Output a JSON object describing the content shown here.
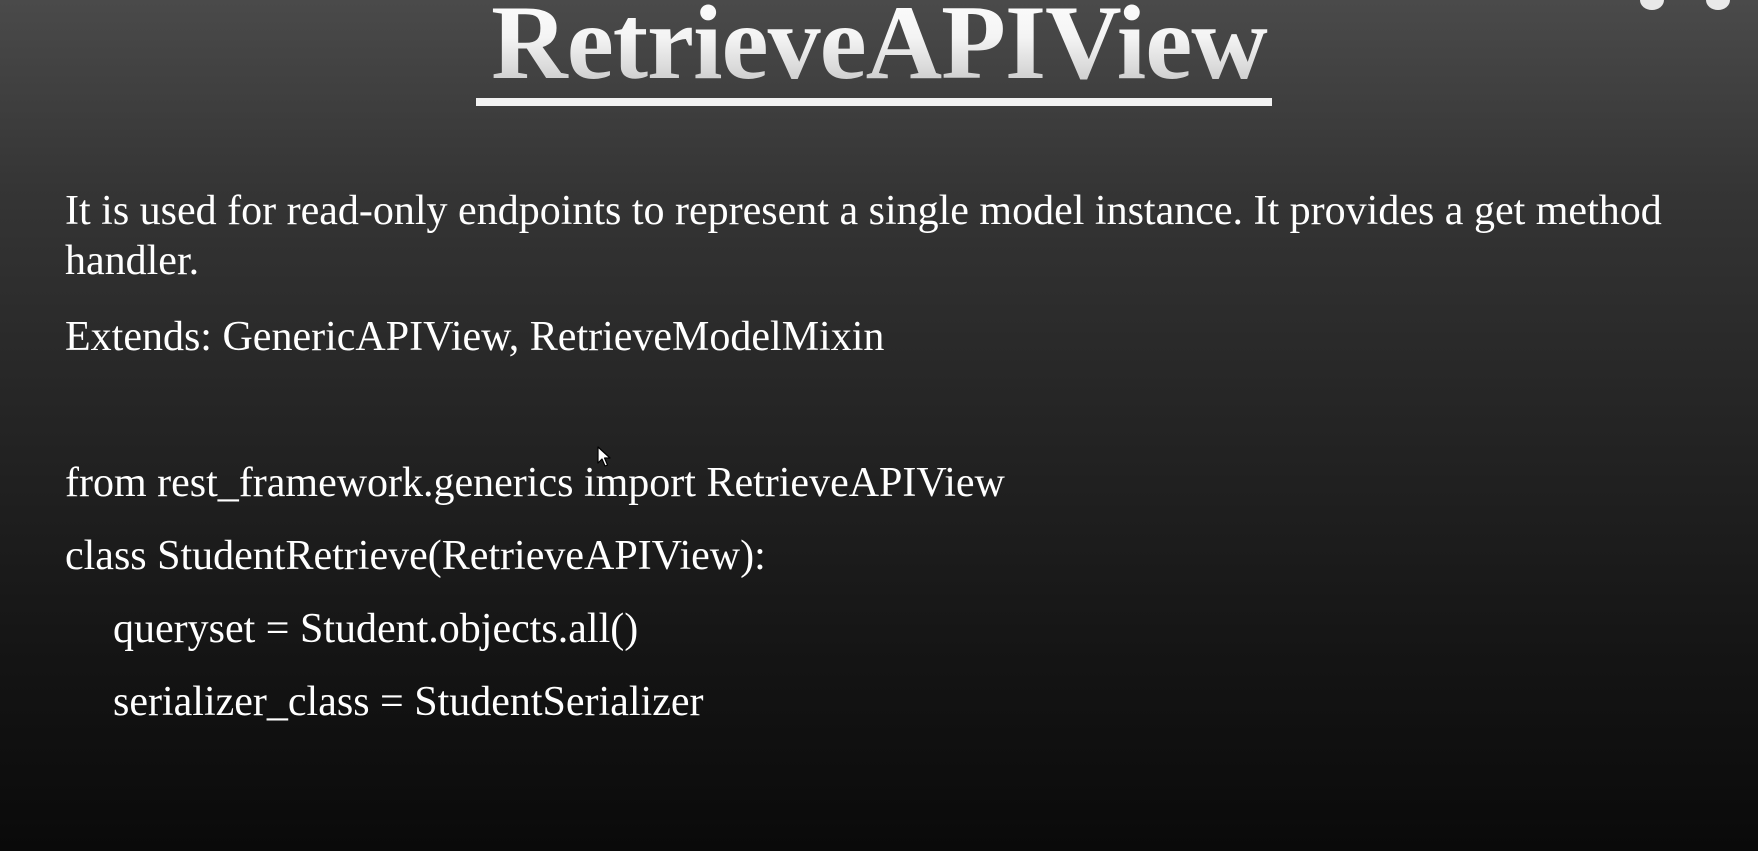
{
  "slide": {
    "title": "RetrieveAPIView",
    "description": "It is used for read-only endpoints to represent a single model instance. It provides a get method handler.",
    "extends_line": "Extends: GenericAPIView, RetrieveModelMixin",
    "code_lines": [
      "from rest_framework.generics import RetrieveAPIView",
      "class StudentRetrieve(RetrieveAPIView):",
      "queryset = Student.objects.all()",
      "serializer_class = StudentSerializer"
    ]
  },
  "icons": {
    "cursor": "mouse-pointer-icon"
  },
  "colors": {
    "text": "#ffffff",
    "background_top": "#4a4a4a",
    "background_bottom": "#0a0a0a"
  }
}
